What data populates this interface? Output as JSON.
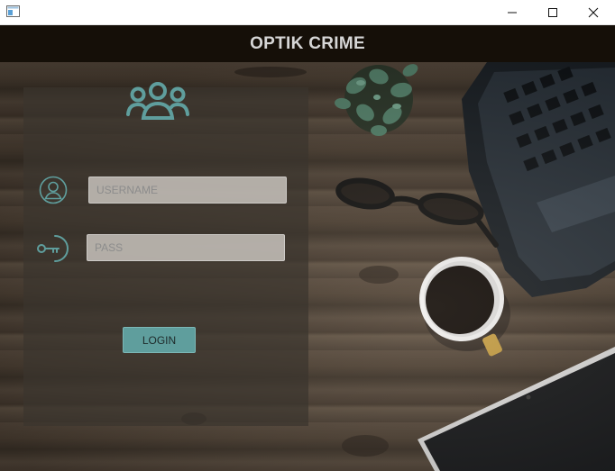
{
  "window": {
    "icons": {
      "app": "app-window-icon",
      "minimize": "minimize-icon",
      "maximize": "maximize-icon",
      "close": "close-icon"
    }
  },
  "header": {
    "title": "OPTIK CRIME"
  },
  "login": {
    "users_icon": "users-group-icon",
    "username_icon": "user-circle-icon",
    "password_icon": "key-icon",
    "username_placeholder": "USERNAME",
    "password_placeholder": "PASS",
    "login_label": "LOGIN"
  },
  "colors": {
    "accent": "#5f9e9d",
    "header_bg": "#150f08",
    "header_text": "#d6d6d6"
  }
}
